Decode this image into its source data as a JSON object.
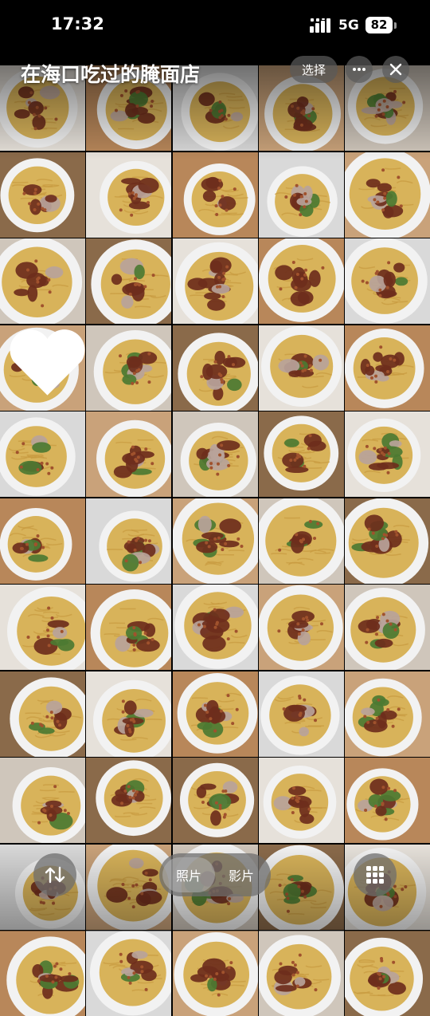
{
  "status_bar": {
    "time": "17:32",
    "network": "5G",
    "battery": "82"
  },
  "album": {
    "title": "在海口吃过的腌面店"
  },
  "actions": {
    "select_label": "选择",
    "more_icon": "ellipsis-icon",
    "close_icon": "close-icon"
  },
  "bottom_bar": {
    "sort_icon": "sort-arrows-icon",
    "segments": [
      {
        "label": "照片",
        "selected": true
      },
      {
        "label": "影片",
        "selected": false
      }
    ],
    "grid_icon": "grid-icon"
  },
  "photos": {
    "columns": 5,
    "rows": 11,
    "favorite_index": 15
  },
  "colors": {
    "noodle": "#d8b35a",
    "meat": "#6e2e1c",
    "greens": "#4c7a32",
    "bowl": "#f2f2f2"
  }
}
